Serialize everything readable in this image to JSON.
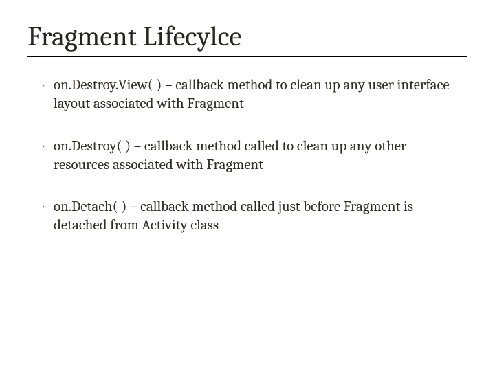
{
  "title": "Fragment Lifecylce",
  "bullets": [
    "on.Destroy.View( ) – callback method to clean up any user interface layout associated with Fragment",
    "on.Destroy( ) – callback method called to clean up any other resources associated with Fragment",
    "on.Detach( ) – callback method called just before Fragment is detached from Activity class"
  ]
}
